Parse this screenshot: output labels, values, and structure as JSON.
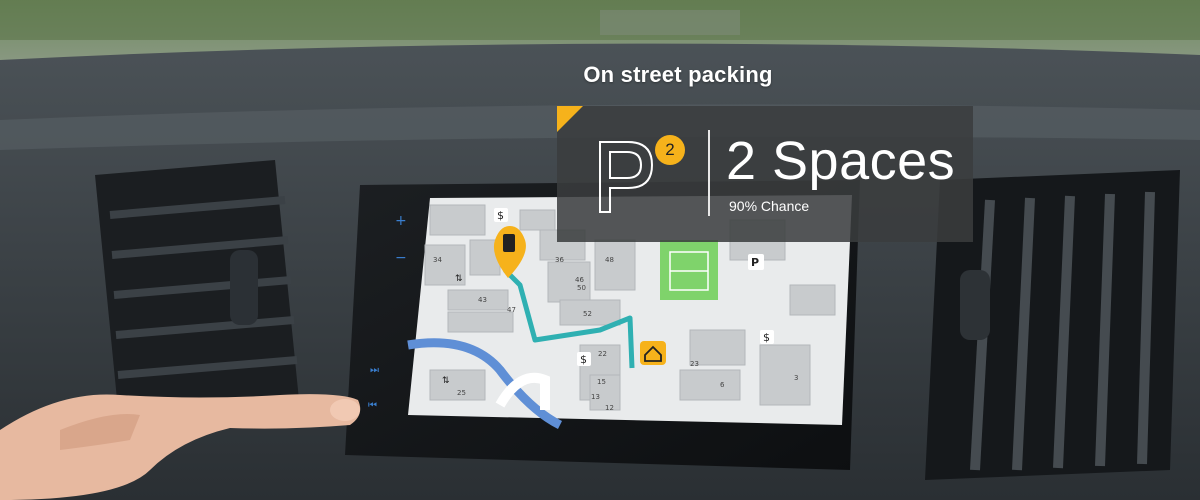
{
  "overlay": {
    "headline": "On street packing",
    "parking_symbol": "P",
    "badge_count": "2",
    "spaces_text": "2 Spaces",
    "chance_text": "90% Chance",
    "accent_color": "#f6b21b"
  },
  "map": {
    "block_labels": [
      "34",
      "36",
      "48",
      "46",
      "43",
      "47",
      "52",
      "50",
      "22",
      "15",
      "13",
      "12",
      "25",
      "23",
      "6",
      "3"
    ],
    "icons": [
      "dollar-sign-icon",
      "parking-p-icon",
      "traffic-sign-icon",
      "car-marker-icon",
      "home-destination-icon"
    ],
    "route_color": "#2fb0b2",
    "water_color": "#5f8fd6"
  },
  "device": {
    "controls": [
      "volume-up",
      "volume-down",
      "skip-forward",
      "skip-back"
    ]
  }
}
